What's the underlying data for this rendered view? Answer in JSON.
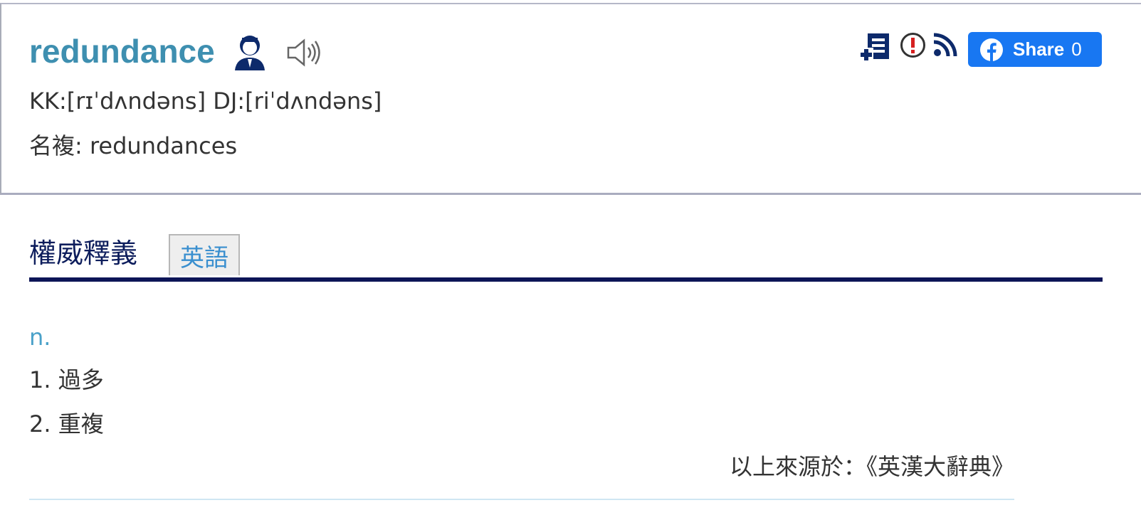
{
  "word": "redundance",
  "icons": {
    "person": "person-avatar-icon",
    "speaker": "speaker-audio-icon",
    "add_list": "add-to-wordlist-icon",
    "report": "report-error-icon",
    "rss": "rss-feed-icon",
    "facebook": "facebook-logo-icon"
  },
  "pronunciation": "KK:[rɪˈdʌndəns] DJ:[riˈdʌndəns]",
  "plural": "名複: redundances",
  "share": {
    "label": "Share",
    "count": "0"
  },
  "tabs": {
    "active": "權威釋義",
    "english": "英語"
  },
  "definitions": {
    "pos": "n.",
    "senses": [
      "1. 過多",
      "2. 重複"
    ]
  },
  "source": "以上來源於：《英漢大辭典》",
  "colors": {
    "title": "#3e8fb0",
    "tab_rule": "#0d1557",
    "share_bg": "#1877f2",
    "pos": "#4aa1c9"
  }
}
